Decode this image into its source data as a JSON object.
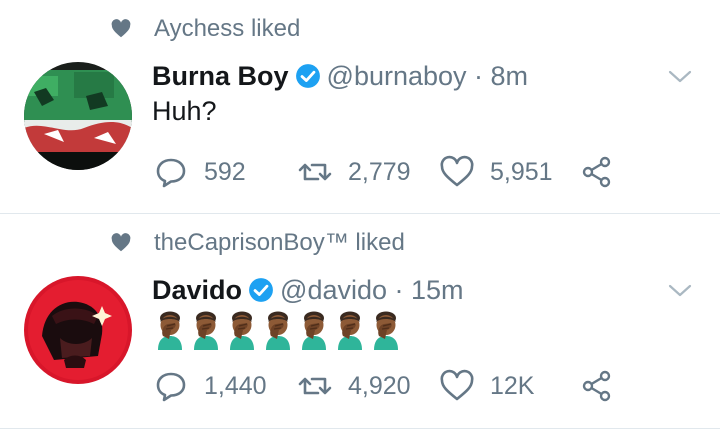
{
  "colors": {
    "accent": "#1da1f2",
    "secondary_text": "#657786",
    "primary_text": "#14171a",
    "divider": "#e1e8ed"
  },
  "tweets": [
    {
      "context": "Aychess liked",
      "display_name": "Burna Boy",
      "handle_time": "@burnaboy · 8m",
      "text": "Huh?",
      "replies": "592",
      "retweets": "2,779",
      "likes": "5,951"
    },
    {
      "context": "theCaprisonBoy™ liked",
      "display_name": "Davido",
      "handle_time": "@davido · 15m",
      "emoji_count": 7,
      "emoji_name": "man-facepalming-emoji",
      "replies": "1,440",
      "retweets": "4,920",
      "likes": "12K"
    }
  ]
}
